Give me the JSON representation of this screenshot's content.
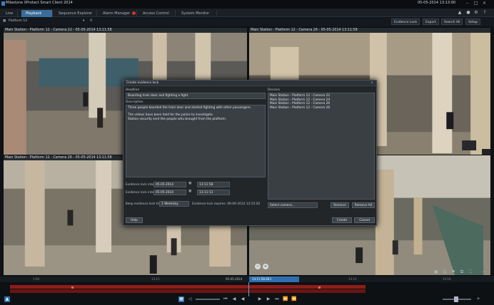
{
  "window": {
    "title": "Milestone XProtect Smart Client 2014",
    "clock": "05-05-2014 13:13:00"
  },
  "tabs": [
    {
      "label": "Live",
      "active": false
    },
    {
      "label": "Playback",
      "active": true
    },
    {
      "label": "Sequence Explorer",
      "active": false
    },
    {
      "label": "Alarm Manager",
      "active": false,
      "badge": true
    },
    {
      "label": "Access Control",
      "active": false
    },
    {
      "label": "System Monitor",
      "active": false
    }
  ],
  "toolbar": {
    "view_name": "Platform 12",
    "evidence_lock": "Evidence Lock",
    "export": "Export",
    "search": "Search All",
    "setup": "Setup"
  },
  "panes": [
    {
      "title": "Main Station - Platform 12 - Camera 22 - 05-05-2014 13:11:58"
    },
    {
      "title": "Main Station - Platform 12 - Camera 26 - 05-05-2014 13:11:58"
    },
    {
      "title": "Main Station - Platform 12 - Camera 26 - 05-05-2014 13:11:58"
    },
    {
      "title": ""
    }
  ],
  "dialog": {
    "title": "Create evidence lock",
    "headline_label": "Headline",
    "headline_value": "Boarding train door and fighting a fight",
    "description_label": "Description",
    "description_lines": [
      "Three people boarded the train door and started fighting with other passengers.",
      "The videos have been held for the police to investigate.",
      "Station security sent the people who brought from the platform."
    ],
    "devices_label": "Devices",
    "devices": [
      "Main Station - Platform 12 - Camera 22",
      "Main Station - Platform 12 - Camera 24",
      "Main Station - Platform 12 - Camera 26",
      "Main Station - Platform 12 - Camera 26"
    ],
    "start_label": "Evidence lock interval start:",
    "start_date": "05-05-2014",
    "start_time": "13:11:58",
    "end_label": "Evidence lock interval end:",
    "end_date": "05-05-2014",
    "end_time": "13:11:13",
    "keep_label": "Keep evidence lock for:",
    "keep_value": "1 Weekday",
    "expires_text": "Evidence lock expires: 06-06-2014 13:15:20",
    "select_camera_placeholder": "Select camera...",
    "remove_button": "Remove",
    "remove_all_button": "Remove All",
    "help_button": "Help",
    "create_button": "Create",
    "cancel_button": "Cancel"
  },
  "timeline": {
    "current_time": "13:11:58.663",
    "left_time": "05-05-2014",
    "ticks": [
      "1:00",
      "13:11",
      "13:13",
      "13:14",
      "1:00"
    ],
    "accent_color": "#c0241f",
    "cursor_color": "#5aa0e0"
  },
  "colors": {
    "active_tab": "#3a6d99",
    "background": "#101316"
  }
}
